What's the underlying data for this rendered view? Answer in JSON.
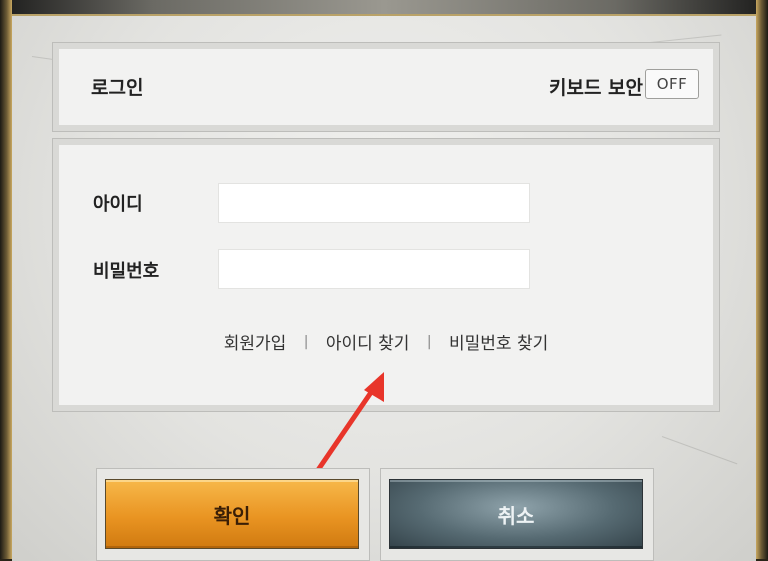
{
  "header": {
    "title": "로그인",
    "keyboard_security_label": "키보드 보안",
    "keyboard_security_toggle": "OFF"
  },
  "form": {
    "id_label": "아이디",
    "id_value": "",
    "password_label": "비밀번호",
    "password_value": ""
  },
  "links": {
    "signup": "회원가입",
    "separator": "|",
    "find_id": "아이디 찾기",
    "find_password": "비밀번호 찾기"
  },
  "buttons": {
    "confirm": "확인",
    "cancel": "취소"
  },
  "annotation": {
    "arrow_color": "#e8352a",
    "arrow_points_to": "find_id"
  },
  "colors": {
    "confirm_button": "#e99422",
    "cancel_button": "#566a72"
  }
}
